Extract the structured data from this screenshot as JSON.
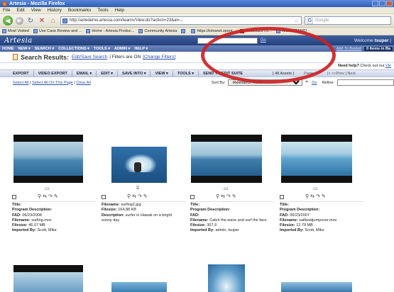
{
  "window": {
    "title": "Artesia - Mozilla Firefox"
  },
  "menu": [
    "File",
    "Edit",
    "View",
    "History",
    "Bookmarks",
    "Tools",
    "Help"
  ],
  "nav": {
    "url": "http://artedemo.artesia.com/teams/View.do?action=23&al=...",
    "search_placeholder": "Google"
  },
  "bookmarks": [
    {
      "label": "Most Visited",
      "icon": "page-icon"
    },
    {
      "label": "Use Case Review and ...",
      "icon": "page-icon"
    },
    {
      "label": "Home - Artesia Produc...",
      "icon": "page-icon"
    },
    {
      "label": "Community Artesia",
      "icon": "page-icon"
    },
    {
      "label": "",
      "icon": "page-icon"
    },
    {
      "label": "https://intranet.opent...",
      "icon": "page-icon"
    },
    {
      "label": "FirstClass Lo...",
      "icon": "red-icon"
    },
    {
      "label": "Artesia DEMO",
      "icon": "page-icon"
    }
  ],
  "app": {
    "logo": "Artesia",
    "go_label": "Go",
    "welcome_prefix": "Welcome",
    "user": "tsuper",
    "menu": [
      "HOME",
      "NEW ▾",
      "SEARCH ▾",
      "COLLECTIONS ▾",
      "TOOLS ▾",
      "ADMIN ▾",
      "HELP ▾"
    ],
    "add_to_basket": "Add To Basket",
    "basket_label": "0 Items in Ba"
  },
  "results": {
    "title": "Search Results:",
    "edit_link": "Edit/Save Search",
    "filters_text": "| Filters are ON",
    "change_filters": "[Change Filters]"
  },
  "help": {
    "prefix": "Need help?",
    "text": "Check out our",
    "link": "Vie"
  },
  "actions": [
    "EXPORT",
    "VIDEO EXPORT",
    "EMAIL ▾",
    "EDIT ▾",
    "SAVE INTO ▾",
    "VIEW ▾",
    "TOOLS ▾",
    "SEND TO EDIT SUITE"
  ],
  "pager": {
    "count": "[ 48 Assets ]",
    "page": "Page: 1",
    "prev": "|< <<Prev | Next"
  },
  "sort": {
    "select_all": "Select All",
    "select_page": "Select All On This Page",
    "clear_all": "Clear All",
    "sort_by": "Sort By:",
    "sort_value": "-Relevance Rank-",
    "go": "Go",
    "refine": "Refine:"
  },
  "assets": [
    {
      "type_icon": "film-icon",
      "lines": [
        [
          "Title:",
          ""
        ],
        [
          "Program Description:",
          ""
        ],
        [
          "FAD:",
          "06/23/2008"
        ],
        [
          "Filename:",
          "surfing.mov"
        ],
        [
          "Filesize:",
          "46.07 MB"
        ],
        [
          "Imported By:",
          "Scott, Mike"
        ]
      ]
    },
    {
      "type_icon": "camera-icon",
      "lines": [
        [
          "Filename:",
          "surfing2.jpg"
        ],
        [
          "Filesize:",
          "164.88 KB"
        ],
        [
          "Description:",
          "surfer in Hawaii on a bright"
        ],
        [
          "",
          "sunny day"
        ]
      ]
    },
    {
      "type_icon": "film-icon",
      "lines": [
        [
          "Title:",
          ""
        ],
        [
          "Program Description:",
          ""
        ],
        [
          "FAD:",
          ""
        ],
        [
          "Filename:",
          "Catch the wave and surf the face"
        ],
        [
          "Filesize:",
          "307.9"
        ],
        [
          "Imported By:",
          "admin, tsuper"
        ]
      ]
    },
    {
      "type_icon": "film-icon",
      "lines": [
        [
          "Title:",
          ""
        ],
        [
          "Program Description:",
          ""
        ],
        [
          "FAD:",
          "06/23/2007"
        ],
        [
          "Filename:",
          "sailboatjumpover.mov"
        ],
        [
          "Filesize:",
          "12.79 MB"
        ],
        [
          "Imported By:",
          "Scott, Mike"
        ]
      ]
    }
  ],
  "colors": {
    "annotation": "#cc2222",
    "app_header": "#2b4a8a",
    "link": "#2a4fa8"
  }
}
